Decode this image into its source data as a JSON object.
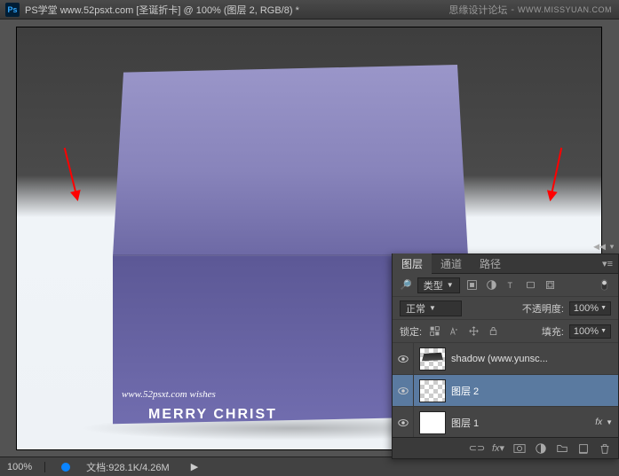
{
  "titlebar": {
    "ps_logo": "Ps",
    "title": "PS学堂  www.52psxt.com [圣诞折卡] @ 100% (图层 2, RGB/8) *"
  },
  "watermark": {
    "text": "思缘设计论坛",
    "domain": "WWW.MISSYUAN.COM"
  },
  "canvas": {
    "text_line": "www.52psxt.com  wishes",
    "merry": "MERRY CHRIST"
  },
  "statusbar": {
    "zoom": "100%",
    "doc_label": "文档:",
    "doc_size": "928.1K/4.26M"
  },
  "panel": {
    "tabs": {
      "layers": "图层",
      "channels": "通道",
      "paths": "路径"
    },
    "filter": {
      "kind": "类型"
    },
    "blend": {
      "mode": "正常",
      "opacity_label": "不透明度:",
      "opacity": "100%"
    },
    "lock": {
      "label": "锁定:",
      "fill_label": "填充:",
      "fill": "100%"
    },
    "layers_list": [
      {
        "name": "shadow (www.yunsc...",
        "visible": true,
        "thumb": "shadow-th"
      },
      {
        "name": "图层 2",
        "visible": true,
        "thumb": "checker",
        "selected": true
      },
      {
        "name": "图层 1",
        "visible": true,
        "thumb": "bg-th",
        "fx": "fx"
      }
    ]
  }
}
